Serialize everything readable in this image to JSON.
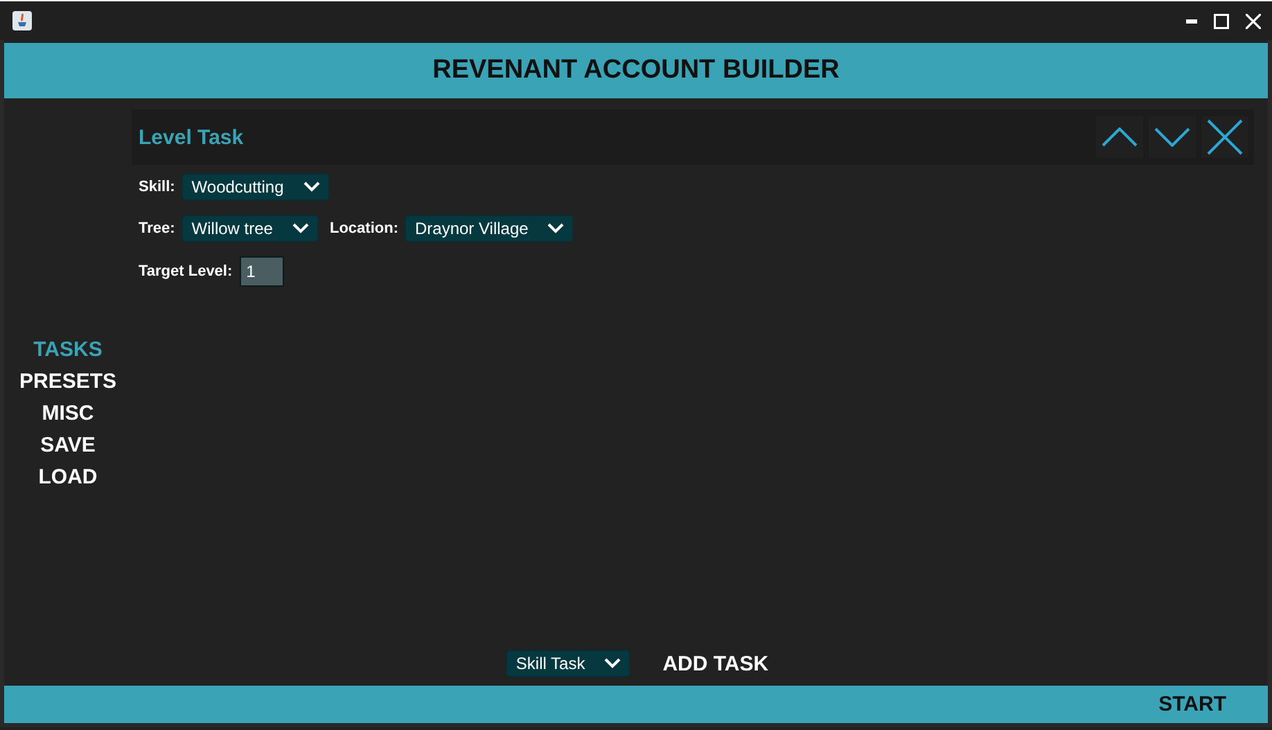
{
  "window": {
    "title_bar": true
  },
  "header": {
    "title": "REVENANT ACCOUNT BUILDER"
  },
  "sidebar": {
    "items": [
      {
        "label": "TASKS",
        "selected": true
      },
      {
        "label": "PRESETS",
        "selected": false
      },
      {
        "label": "MISC",
        "selected": false
      },
      {
        "label": "SAVE",
        "selected": false
      },
      {
        "label": "LOAD",
        "selected": false
      }
    ]
  },
  "task_panel": {
    "title": "Level Task",
    "rows": [
      [
        {
          "kind": "select",
          "label": "Skill:",
          "value": "Woodcutting"
        }
      ],
      [
        {
          "kind": "select",
          "label": "Tree:",
          "value": "Willow tree"
        },
        {
          "kind": "select",
          "label": "Location:",
          "value": "Draynor Village"
        }
      ],
      [
        {
          "kind": "input",
          "label": "Target Level:",
          "value": "1"
        }
      ]
    ]
  },
  "footer": {
    "task_type": "Skill Task",
    "add_button": "ADD TASK",
    "start_button": "START"
  }
}
